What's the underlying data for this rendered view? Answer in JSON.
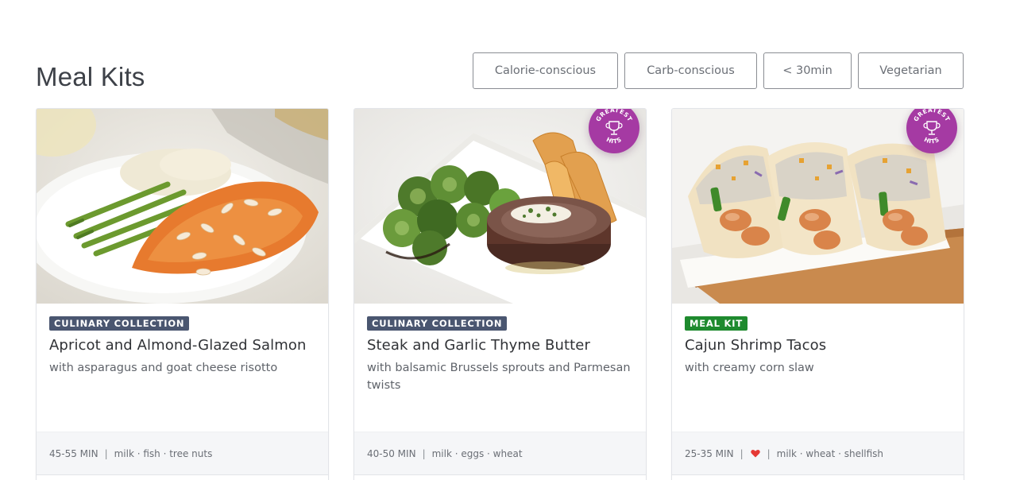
{
  "page": {
    "title": "Meal Kits"
  },
  "filters": [
    {
      "label": "Calorie-conscious"
    },
    {
      "label": "Carb-conscious"
    },
    {
      "label": "< 30min"
    },
    {
      "label": "Vegetarian"
    }
  ],
  "badge": {
    "text": "GREATEST HITS",
    "icon": "trophy-icon",
    "color": "#a53aa3"
  },
  "cards": [
    {
      "tag": "CULINARY COLLECTION",
      "tag_color": "#4a5670",
      "title": "Apricot and Almond-Glazed Salmon",
      "subtitle": "with asparagus and goat cheese risotto",
      "time": "45-55 MIN",
      "allergens": "milk · fish · tree nuts",
      "greatest_hits": false,
      "favorite": false
    },
    {
      "tag": "CULINARY COLLECTION",
      "tag_color": "#4a5670",
      "title": "Steak and Garlic Thyme Butter",
      "subtitle": "with balsamic Brussels sprouts and Parmesan twists",
      "time": "40-50 MIN",
      "allergens": "milk · eggs · wheat",
      "greatest_hits": true,
      "favorite": false
    },
    {
      "tag": "MEAL KIT",
      "tag_color": "#1e8a2e",
      "title": "Cajun Shrimp Tacos",
      "subtitle": "with creamy corn slaw",
      "time": "25-35 MIN",
      "allergens": "milk · wheat · shellfish",
      "greatest_hits": true,
      "favorite": true
    }
  ]
}
